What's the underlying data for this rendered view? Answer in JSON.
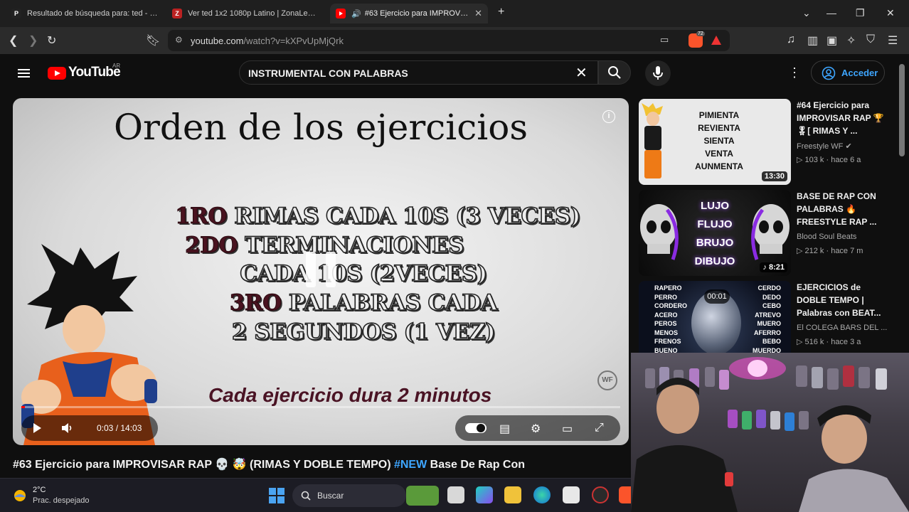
{
  "browser": {
    "tabs": [
      {
        "label": "Resultado de búsqueda para: ted - Pe",
        "favicon": "P"
      },
      {
        "label": "Ver ted 1x2 1080p Latino | ZonaLeRos",
        "favicon": "Z"
      },
      {
        "label": "#63 Ejercicio para IMPROVISAR RAP",
        "favicon": "youtube-icon",
        "active": true
      }
    ],
    "url_host": "youtube.com",
    "url_path": "/watch?v=kXPvUpMjQrk",
    "brave_badge": "72"
  },
  "youtube": {
    "logo_text": "YouTube",
    "country_code": "AR",
    "search_query": "INSTRUMENTAL CON PALABRAS",
    "signin_label": "Acceder"
  },
  "player": {
    "slide_title": "Orden de los ejercicios",
    "rules": [
      {
        "num": "1RO",
        "text": "RIMAS CADA 10S (3 VECES)"
      },
      {
        "num": "2DO",
        "text": "TERMINACIONES"
      },
      {
        "num": "",
        "text": "CADA 10S (2VECES)"
      },
      {
        "num": "3RO",
        "text": "PALABRAS CADA"
      },
      {
        "num": "",
        "text": "2 SEGUNDOS (1 VEZ)"
      }
    ],
    "slide_note": "Cada ejercicio dura 2 minutos",
    "watermark": "WF",
    "time_current": "0:03",
    "time_total": "14:03",
    "progress_fraction": 0.0036
  },
  "video": {
    "title_main": "#63 Ejercicio para IMPROVISAR RAP 💀 🤯 (RIMAS Y DOBLE TEMPO) ",
    "title_tag": "#NEW",
    "title_end": " Base De Rap Con"
  },
  "recommendations": [
    {
      "title": "#64 Ejercicio para IMPROVISAR RAP 🏆🎖[ RIMAS Y ...",
      "channel": "Freestyle WF ✔",
      "meta": "103 k · hace 6 a",
      "duration": "13:30",
      "thumb_words": [
        "PIMIENTA",
        "REVIENTA",
        "SIENTA",
        "VENTA",
        "AUNMENTA"
      ]
    },
    {
      "title": "BASE DE RAP CON PALABRAS 🔥 FREESTYLE RAP ...",
      "channel": "Blood Soul Beats",
      "meta": "212 k · hace 7 m",
      "duration": "8:21",
      "thumb_words": [
        "LUJO",
        "FLUJO",
        "BRUJO",
        "DIBUJO"
      ]
    },
    {
      "title": "EJERCICIOS de DOBLE TEMPO | Palabras con BEAT...",
      "channel": "El COLEGA BARS DEL ...",
      "meta": "516 k · hace 3 a",
      "duration": "",
      "timer": "00:01",
      "thumb_words_left": [
        "RAPERO",
        "PERRO",
        "CORDERO",
        "ACERO",
        "PEROS",
        "MENOS",
        "FRENOS",
        "BUENO"
      ],
      "thumb_words_right": [
        "CERDO",
        "DEDO",
        "CEBO",
        "ATREVO",
        "MUERO",
        "AFERRO",
        "BEBO",
        "MUERDO"
      ]
    }
  ],
  "taskbar": {
    "temperature": "2°C",
    "weather": "Prac. despejado",
    "search_label": "Buscar"
  },
  "colors": {
    "yt_red": "#ff0000",
    "link_blue": "#3ea6ff",
    "background": "#0f0f0f"
  }
}
